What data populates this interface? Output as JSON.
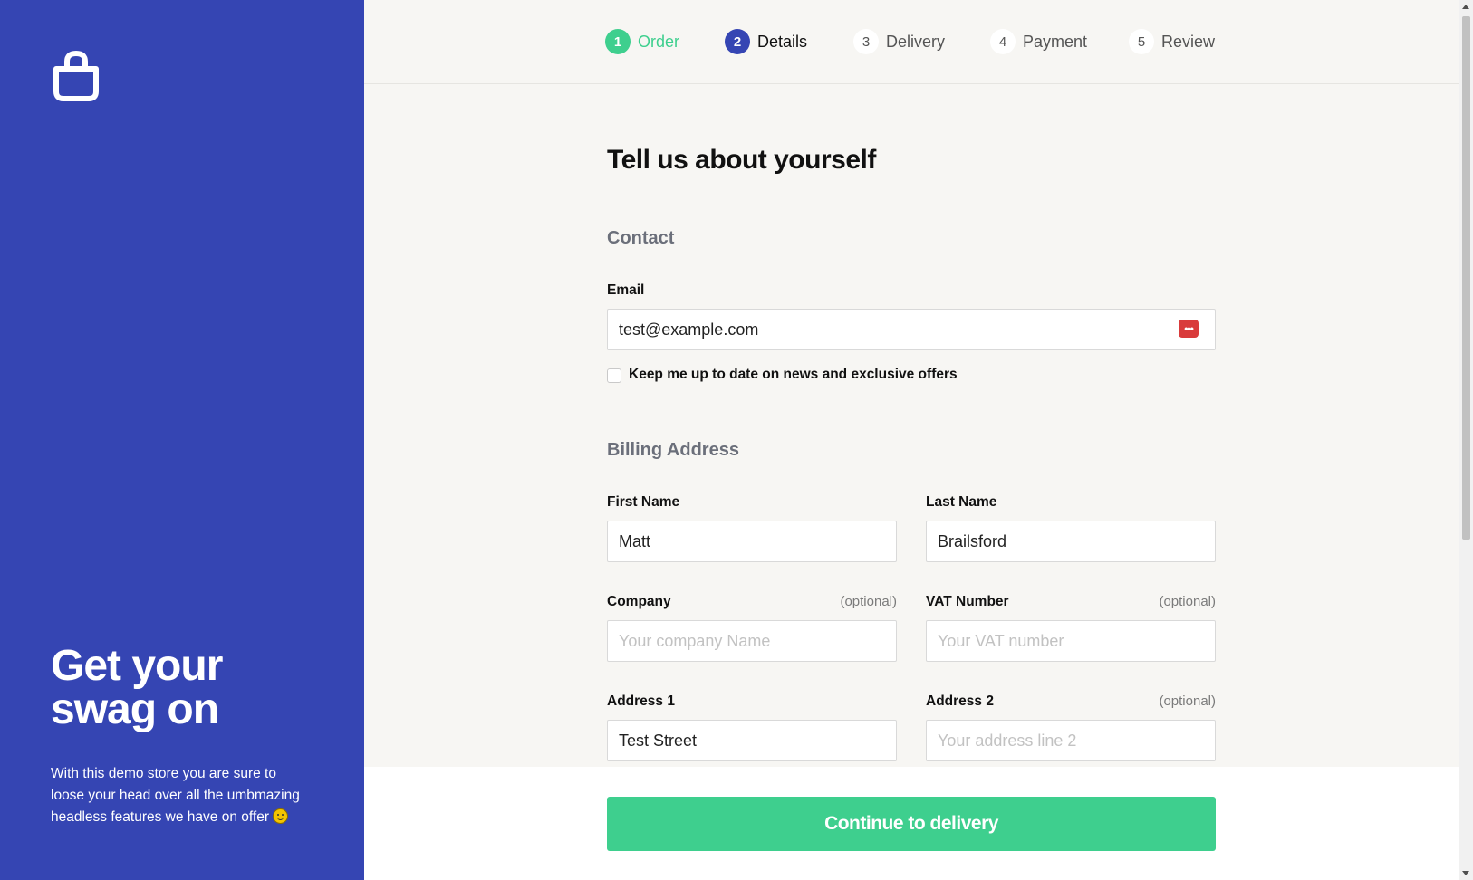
{
  "sidebar": {
    "logo_icon": "shopping-bag-icon",
    "headline": "Get your swag on",
    "tagline": "With this demo store you are sure to loose your head over all the umbmazing headless features we have on offer",
    "emoji_icon": "smiling-face-icon"
  },
  "steps": [
    {
      "number": "1",
      "label": "Order",
      "state": "done"
    },
    {
      "number": "2",
      "label": "Details",
      "state": "active"
    },
    {
      "number": "3",
      "label": "Delivery",
      "state": "todo"
    },
    {
      "number": "4",
      "label": "Payment",
      "state": "todo"
    },
    {
      "number": "5",
      "label": "Review",
      "state": "todo"
    }
  ],
  "form": {
    "title": "Tell us about yourself",
    "contact_heading": "Contact",
    "email": {
      "label": "Email",
      "value": "test@example.com",
      "autofill_icon": "password-manager-icon"
    },
    "newsletter": {
      "label": "Keep me up to date on news and exclusive offers",
      "checked": false
    },
    "billing_heading": "Billing Address",
    "first_name": {
      "label": "First Name",
      "value": "Matt"
    },
    "last_name": {
      "label": "Last Name",
      "value": "Brailsford"
    },
    "company": {
      "label": "Company",
      "optional": "(optional)",
      "value": "",
      "placeholder": "Your company Name"
    },
    "vat": {
      "label": "VAT Number",
      "optional": "(optional)",
      "value": "",
      "placeholder": "Your VAT number"
    },
    "address1": {
      "label": "Address 1",
      "value": "Test Street"
    },
    "address2": {
      "label": "Address 2",
      "optional": "(optional)",
      "value": "",
      "placeholder": "Your address line 2"
    }
  },
  "footer": {
    "continue_label": "Continue to delivery"
  },
  "colors": {
    "brand_blue": "#3545b3",
    "accent_green": "#3ecf8e",
    "background": "#f7f6f3"
  }
}
